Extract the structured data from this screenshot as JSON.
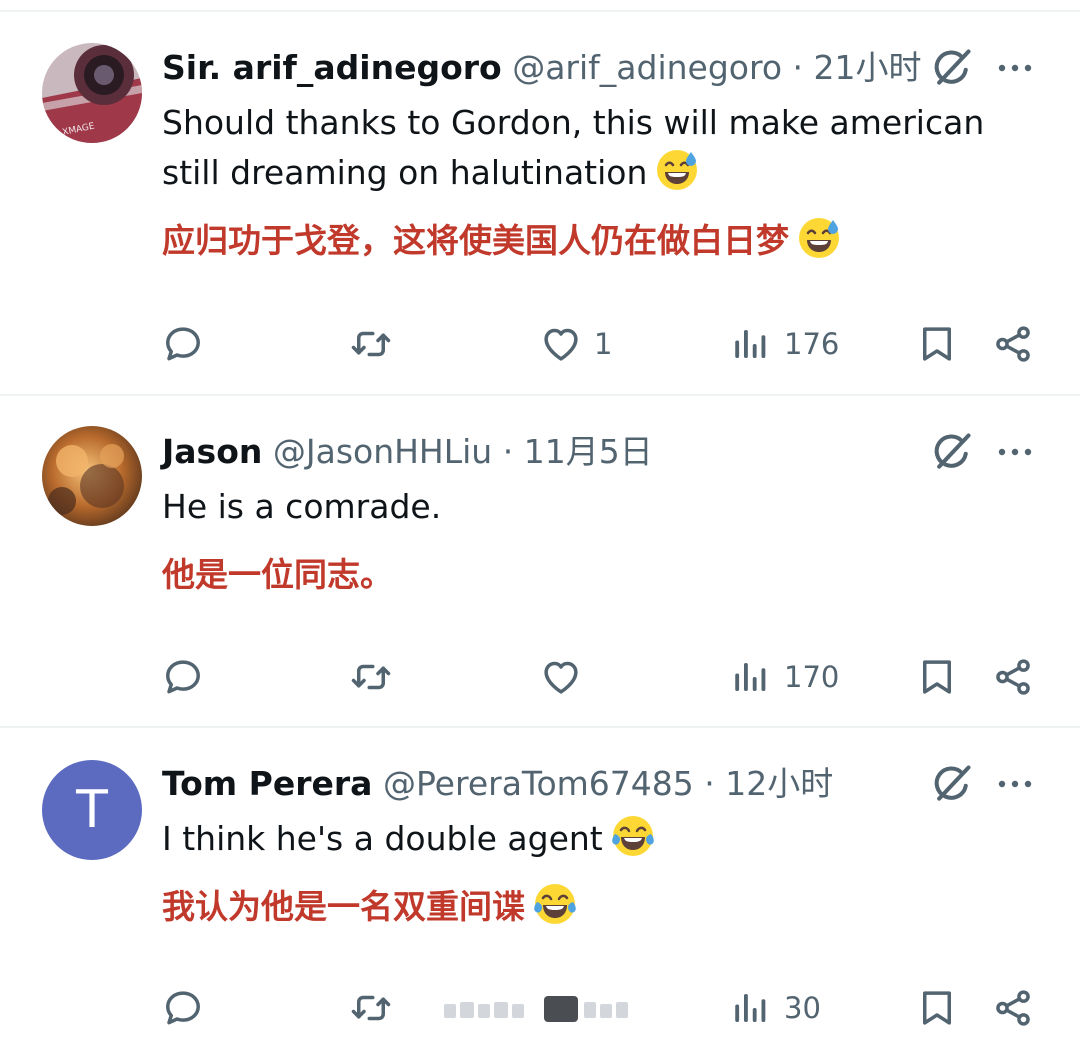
{
  "tweets": [
    {
      "name": "Sir. arif_adinegoro",
      "handle": "@arif_adinegoro",
      "separator": "·",
      "time": "21小时",
      "text_line1": "Should thanks to Gordon, this will make american",
      "text_line2": "still dreaming on halutination",
      "translation": "应归功于戈登，这将使美国人仍在做白日梦",
      "emoji": "sweat-smile-emoji",
      "likes": "1",
      "views": "176"
    },
    {
      "name": "Jason",
      "handle": "@JasonHHLiu",
      "separator": "·",
      "time": "11月5日",
      "text_line1": "He is a comrade.",
      "translation": "他是一位同志。",
      "likes": "",
      "views": "170"
    },
    {
      "name": "Tom Perera",
      "handle": "@PereraTom67485",
      "separator": "·",
      "time": "12小时",
      "avatar_letter": "T",
      "text_line1": "I think he's a double agent",
      "translation": "我认为他是一名双重间谍",
      "emoji": "tears-of-joy-emoji",
      "likes": "",
      "views": "30"
    }
  ],
  "colors": {
    "text": "#0f1419",
    "secondary": "#536471",
    "translation": "#c0392b",
    "avatar_t": "#5c6bc0",
    "divider": "#eff3f4"
  },
  "icons": [
    "reply-icon",
    "retweet-icon",
    "like-icon",
    "views-icon",
    "bookmark-icon",
    "share-icon",
    "grok-icon",
    "more-icon"
  ]
}
